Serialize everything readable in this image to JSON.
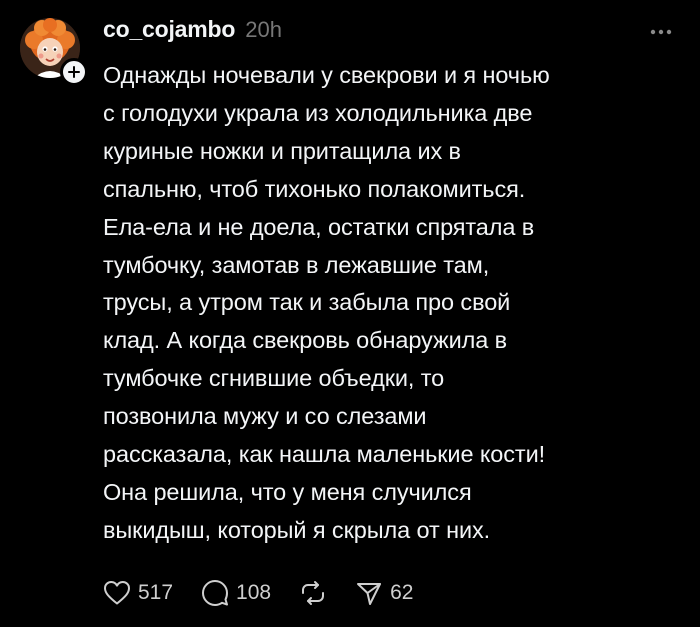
{
  "post": {
    "username": "co_cojambo",
    "timestamp": "20h",
    "text": "Однажды ночевали у свекрови и я ночью\nс голодухи украла из холодильника две\nкуриные ножки и притащила их в\nспальню, чтоб тихонько полакомиться.\nЕла-ела и не доела, остатки спрятала в\nтумбочку, замотав в лежавшие там,\nтрусы, а утром так и забыла про свой\nклад. А когда свекровь обнаружила в\nтумбочке сгнившие объедки, то\nпозвонила мужу и со слезами\nрассказала, как нашла маленькие кости!\nОна решила, что у меня случился\nвыкидыш, который я скрыла от них."
  },
  "actions": {
    "like_count": "517",
    "comment_count": "108",
    "share_count": "62"
  },
  "icons": {
    "avatar": "cartoon-redhead-avatar",
    "follow": "plus-icon",
    "more": "more-horizontal-icon",
    "like": "heart-icon",
    "comment": "comment-bubble-icon",
    "repost": "repost-icon",
    "share": "send-icon"
  },
  "colors": {
    "background": "#000000",
    "text": "#f3f5f7",
    "muted": "#777777"
  }
}
